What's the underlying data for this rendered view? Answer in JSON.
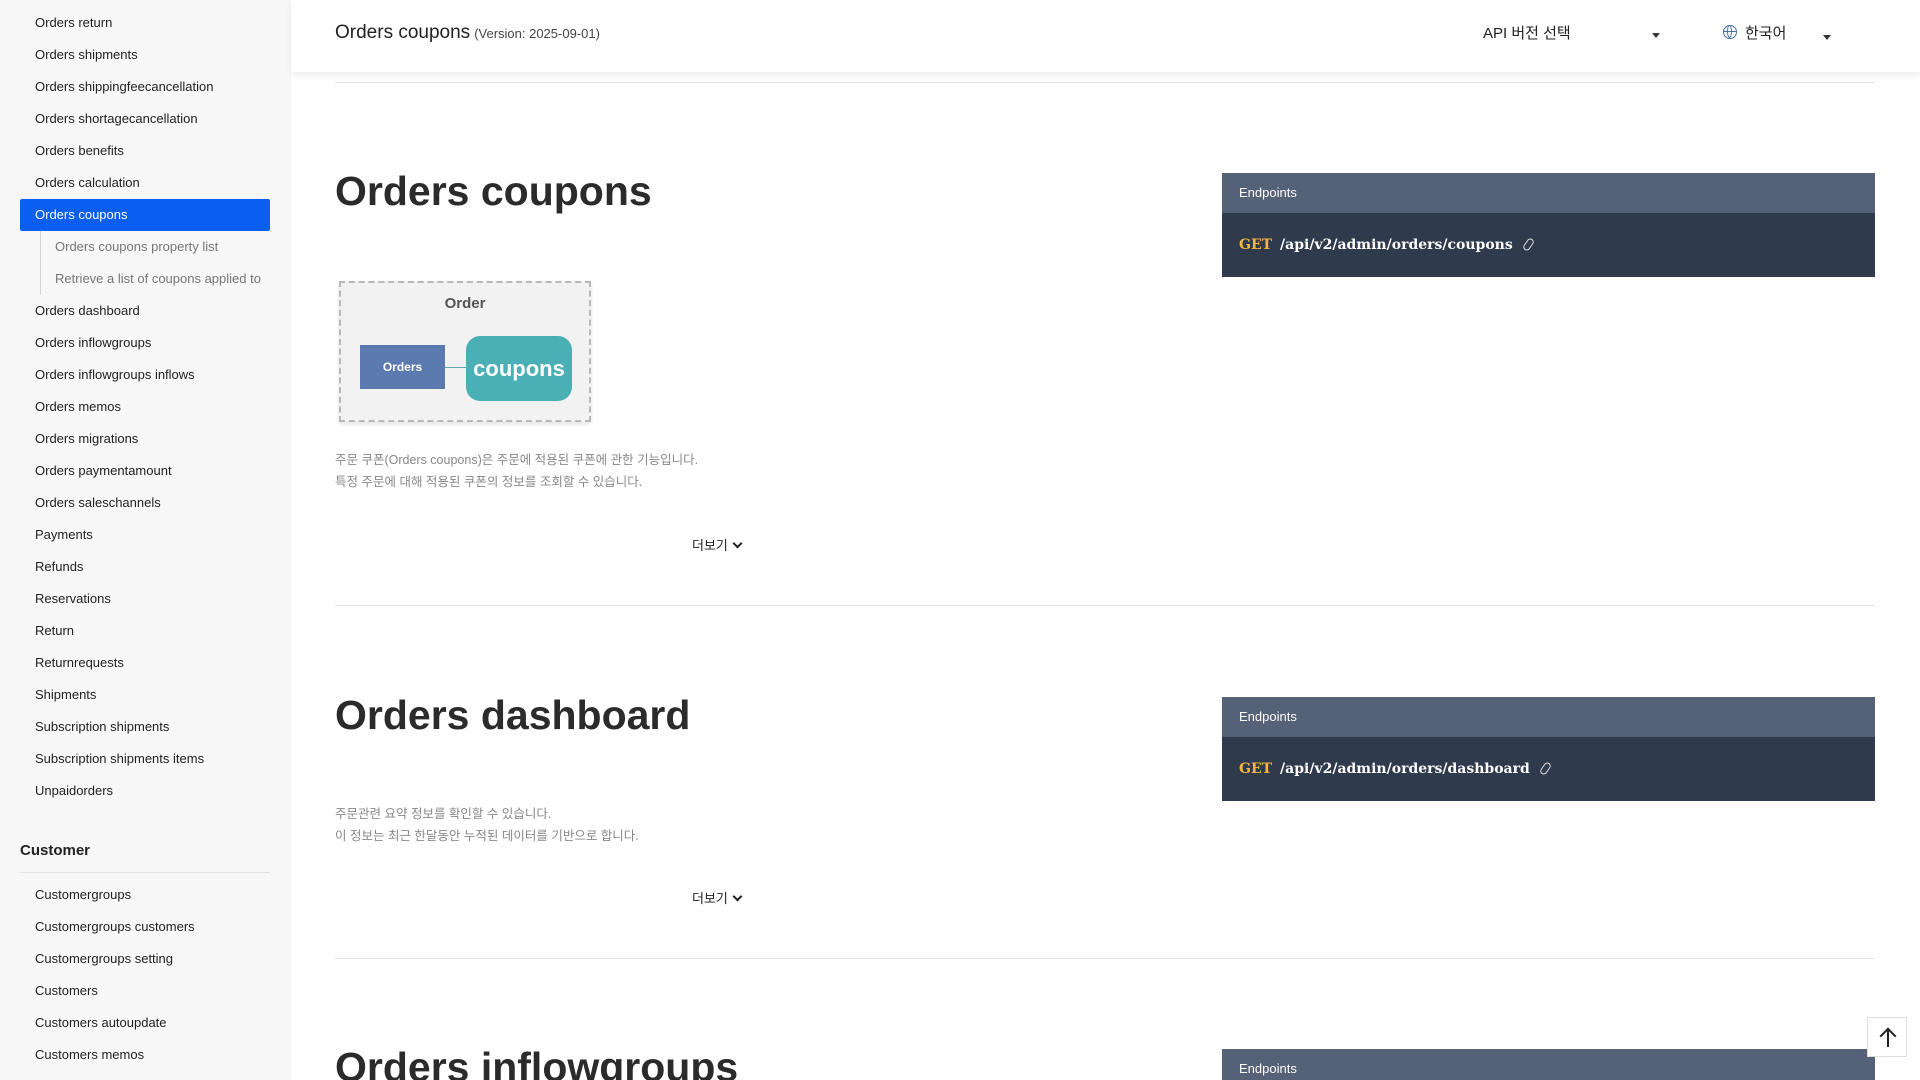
{
  "sidebar": {
    "items": [
      {
        "label": "Orders return",
        "active": false
      },
      {
        "label": "Orders shipments",
        "active": false
      },
      {
        "label": "Orders shippingfeecancellation",
        "active": false
      },
      {
        "label": "Orders shortagecancellation",
        "active": false
      },
      {
        "label": "Orders benefits",
        "active": false
      },
      {
        "label": "Orders calculation",
        "active": false
      },
      {
        "label": "Orders coupons",
        "active": true
      }
    ],
    "sub_items": [
      "Orders coupons property list",
      "Retrieve a list of coupons applied to"
    ],
    "items_after": [
      "Orders dashboard",
      "Orders inflowgroups",
      "Orders inflowgroups inflows",
      "Orders memos",
      "Orders migrations",
      "Orders paymentamount",
      "Orders saleschannels",
      "Payments",
      "Refunds",
      "Reservations",
      "Return",
      "Returnrequests",
      "Shipments",
      "Subscription shipments",
      "Subscription shipments items",
      "Unpaidorders"
    ],
    "customer_section": {
      "title": "Customer",
      "items": [
        "Customergroups",
        "Customergroups customers",
        "Customergroups setting",
        "Customers",
        "Customers autoupdate",
        "Customers memos"
      ]
    }
  },
  "header": {
    "title": "Orders coupons",
    "version": "(Version: 2025-09-01)",
    "api_select_label": "API 버전 선택",
    "language_label": "한국어"
  },
  "sections": [
    {
      "title": "Orders coupons",
      "description_lines": [
        "주문 쿠폰(Orders coupons)은 주문에 적용된 쿠폰에 관한 기능입니다.",
        "특정 주문에 대해 적용된 쿠폰의 정보를 조회할 수 있습니다."
      ],
      "more_label": "더보기",
      "endpoints_label": "Endpoints",
      "method": "GET",
      "path": "/api/v2/admin/orders/coupons",
      "diagram": {
        "title": "Order",
        "left_box": "Orders",
        "right_box": "coupons"
      }
    },
    {
      "title": "Orders dashboard",
      "description_lines": [
        "주문관련 요약 정보를 확인할 수 있습니다.",
        "이 정보는 최근 한달동안 누적된 데이터를 기반으로 합니다."
      ],
      "more_label": "더보기",
      "endpoints_label": "Endpoints",
      "method": "GET",
      "path": "/api/v2/admin/orders/dashboard"
    },
    {
      "title": "Orders inflowgroups",
      "endpoints_label": "Endpoints"
    }
  ],
  "colors": {
    "accent": "#0b5ff0",
    "endpoint_header": "#556177",
    "endpoint_body": "#2f3a4d",
    "method": "#f5b73b"
  },
  "icons": {
    "language": "globe-icon",
    "scroll_top": "arrow-up-icon",
    "link": "link-icon",
    "dropdown": "caret-down-icon"
  }
}
